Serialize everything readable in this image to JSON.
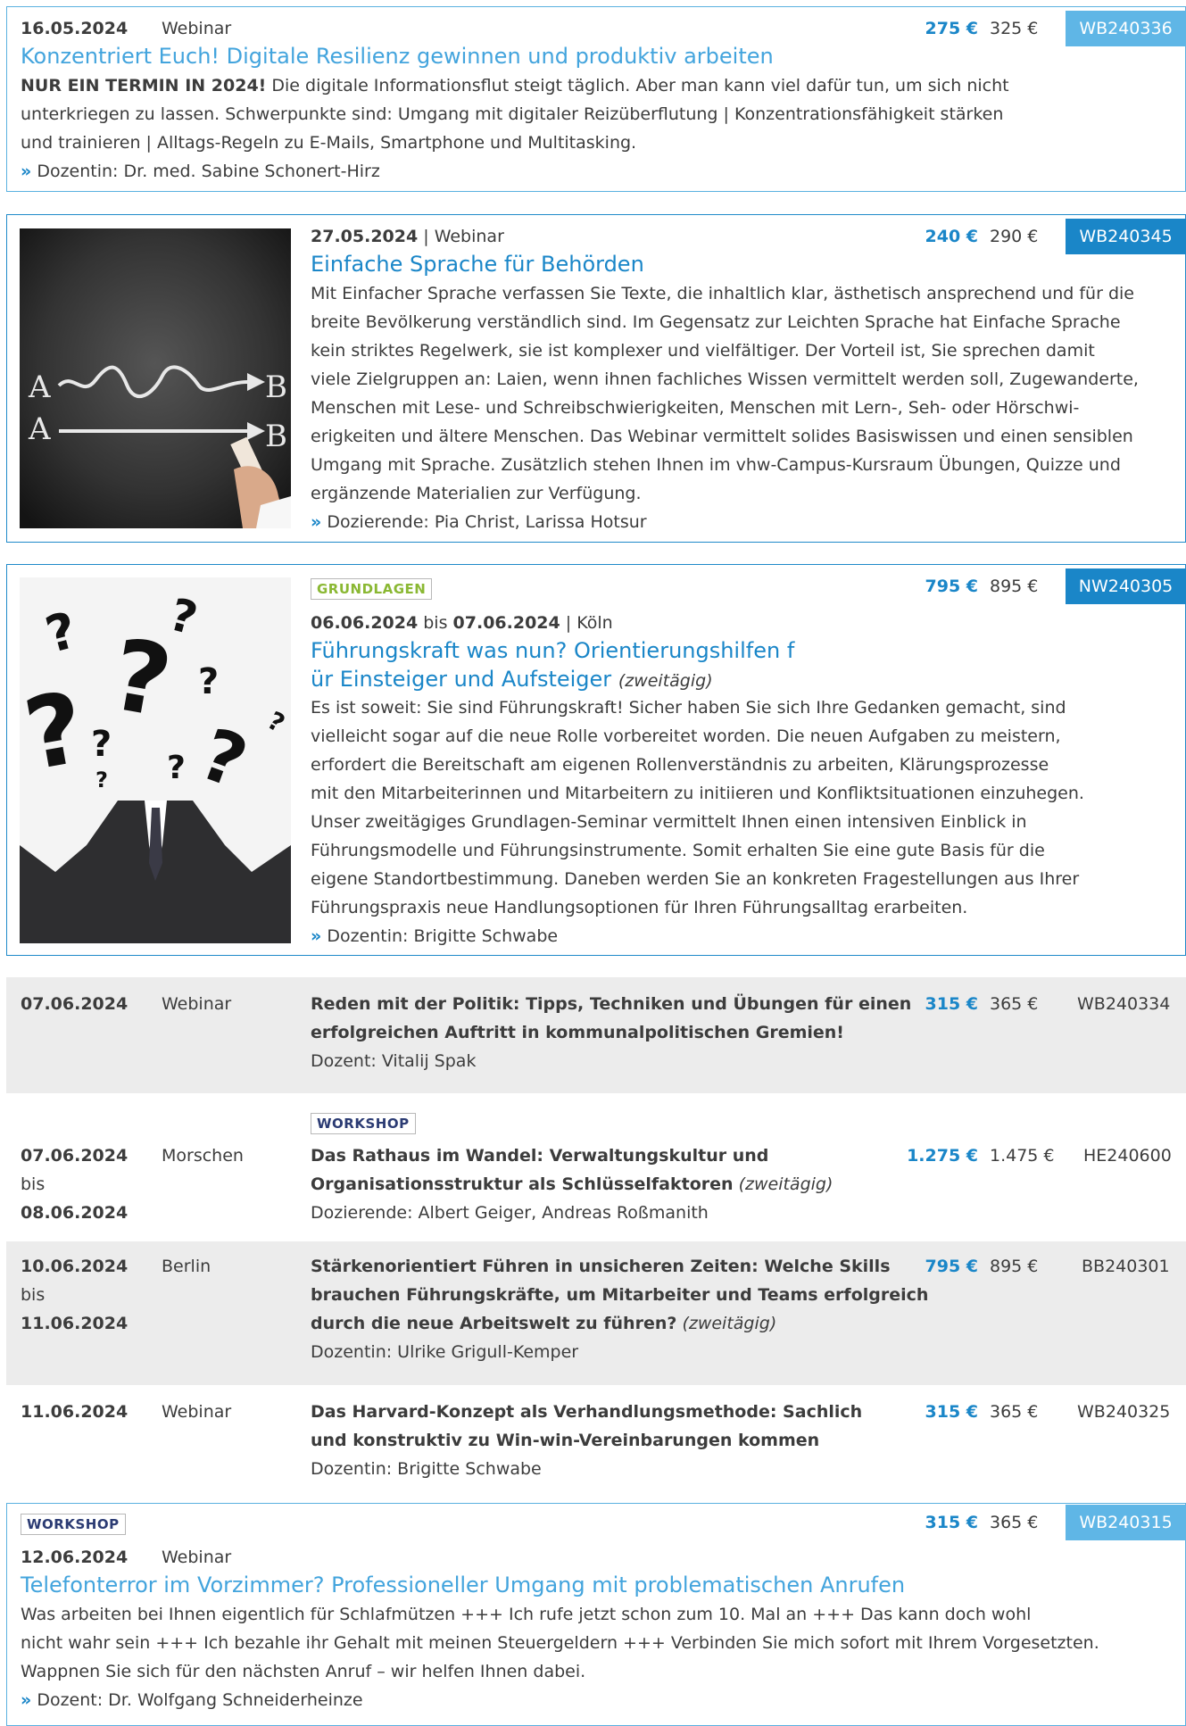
{
  "entry1": {
    "date": "16.05.2024",
    "format": "Webinar",
    "title": "Konzentriert Euch! Digitale Resilienz gewinnen und produktiv arbeiten",
    "lead_bold": "NUR EIN TERMIN IN 2024!",
    "desc_line1": " Die digitale Informationsflut steigt täglich. Aber man kann viel dafür tun, um sich nicht",
    "desc_line2": "unterkriegen zu lassen. Schwerpunkte sind: Umgang mit digitaler Reizüberflutung | Konzentrationsfähigkeit stärken",
    "desc_line3": "und trainieren | Alltags-Regeln zu E-Mails, Smartphone und Multitasking.",
    "teacher": "Dozentin: Dr. med. Sabine Schonert-Hirz",
    "price_new": "275 €",
    "price_old": "325 €",
    "code": "WB240336"
  },
  "entry2": {
    "date": "27.05.2024",
    "sep": " | ",
    "format": "Webinar",
    "title": "Einfache Sprache für Behörden",
    "lines": [
      "Mit Einfacher Sprache verfassen Sie Texte, die inhaltlich klar, ästhetisch ansprechend und für die",
      "breite Bevölkerung verständlich sind. Im Gegensatz zur Leichten Sprache hat Einfache Sprache",
      "kein striktes Regelwerk, sie ist komplexer und vielfältiger. Der Vorteil ist, Sie sprechen damit",
      "viele Zielgruppen an: Laien, wenn ihnen fachliches Wissen vermittelt werden soll, Zugewanderte,",
      "Menschen mit Lese- und Schreibschwierigkeiten, Menschen mit Lern-, Seh- oder Hörschwi-",
      "erigkeiten und ältere Menschen. Das Webinar vermittelt solides Basiswissen und einen sensiblen",
      "Umgang mit Sprache. Zusätzlich stehen Ihnen im vhw-Campus-Kursraum Übungen, Quizze und",
      "ergänzende Materialien zur Verfügung."
    ],
    "teacher": "Dozierende: Pia Christ, Larissa Hotsur",
    "price_new": "240 €",
    "price_old": "290 €",
    "code": "WB240345",
    "image_text": {
      "a1": "A",
      "b1": "B",
      "a2": "A",
      "b2": "B"
    }
  },
  "entry3": {
    "tag": "GRUNDLAGEN",
    "date_from": "06.06.2024",
    "bis": " bis ",
    "date_to": "07.06.2024",
    "sep": " | ",
    "location": "Köln",
    "title_line1": "Führungskraft was nun? Orientierungshilfen f",
    "title_line2": "ür Einsteiger und Aufsteiger",
    "duration": "(zweitägig)",
    "lines": [
      "Es ist soweit: Sie sind Führungskraft! Sicher haben Sie sich Ihre Gedanken gemacht, sind",
      "vielleicht sogar auf die neue Rolle vorbereitet worden. Die neuen Aufgaben zu meistern,",
      "erfordert die Bereitschaft am eigenen Rollenverständnis zu arbeiten, Klärungsprozesse",
      "mit den Mitarbeiterinnen und Mitarbeitern zu initiieren und Konfliktsituationen einzuhegen.",
      "Unser zweitägiges Grundlagen-Seminar vermittelt Ihnen einen intensiven Einblick in",
      "Führungsmodelle und Führungsinstrumente. Somit erhalten Sie eine gute Basis für die",
      "eigene Standortbestimmung. Daneben werden Sie an konkreten Fragestellungen aus Ihrer",
      "Führungspraxis neue Handlungsoptionen für Ihren Führungsalltag erarbeiten."
    ],
    "teacher": "Dozentin: Brigitte Schwabe",
    "price_new": "795 €",
    "price_old": "895 €",
    "code": "NW240305"
  },
  "rows": {
    "r1": {
      "date": "07.06.2024",
      "format": "Webinar",
      "title_line1": "Reden mit der Politik: Tipps, Techniken und Übungen für einen",
      "title_line2": "erfolgreichen Auftritt in kommunalpolitischen Gremien!",
      "teacher": "Dozent: Vitalij Spak",
      "price_new": "315 €",
      "price_old": "365 €",
      "code": "WB240334"
    },
    "r2": {
      "tag": "WORKSHOP",
      "date_from": "07.06.2024",
      "bis": "bis",
      "date_to": "08.06.2024",
      "location": "Morschen",
      "title_line1": "Das Rathaus im Wandel: Verwaltungskultur und",
      "title_line2": "Organisationsstruktur als Schlüsselfaktoren",
      "duration": " (zweitägig)",
      "teacher": "Dozierende: Albert Geiger, Andreas Roßmanith",
      "price_new": "1.275 €",
      "price_old": "1.475 €",
      "code": "HE240600"
    },
    "r3": {
      "date_from": "10.06.2024",
      "bis": "bis",
      "date_to": "11.06.2024",
      "location": "Berlin",
      "title_line1": "Stärkenorientiert Führen in unsicheren Zeiten: Welche Skills",
      "title_line2": "brauchen Führungskräfte, um Mitarbeiter und Teams erfolgreich",
      "title_line3": "durch die neue Arbeitswelt zu führen?",
      "duration": " (zweitägig)",
      "teacher": "Dozentin: Ulrike Grigull-Kemper",
      "price_new": "795 €",
      "price_old": "895 €",
      "code": "BB240301"
    },
    "r4": {
      "date": "11.06.2024",
      "format": "Webinar",
      "title_line1": "Das Harvard-Konzept als Verhandlungsmethode: Sachlich",
      "title_line2": "und konstruktiv zu Win-win-Vereinbarungen kommen",
      "teacher": "Dozentin: Brigitte Schwabe",
      "price_new": "315 €",
      "price_old": "365 €",
      "code": "WB240325"
    }
  },
  "entry4": {
    "tag": "WORKSHOP",
    "date": "12.06.2024",
    "format": "Webinar",
    "title": "Telefonterror im Vorzimmer? Professioneller Umgang mit problematischen Anrufen",
    "line1": "Was arbeiten bei Ihnen eigentlich für Schlafmützen +++ Ich rufe jetzt schon zum 10. Mal an +++ Das kann doch wohl",
    "line2": "nicht wahr sein +++ Ich bezahle ihr Gehalt mit meinen Steuergeldern +++ Verbinden Sie mich sofort mit Ihrem Vorgesetzten.",
    "line3": "Wappnen Sie sich für den nächsten Anruf – wir helfen Ihnen dabei.",
    "teacher": "Dozent: Dr. Wolfgang Schneiderheinze",
    "price_new": "315 €",
    "price_old": "365 €",
    "code": "WB240315"
  },
  "arrow_glyph": "»",
  "colors": {
    "accent": "#1a86c8",
    "accent_light": "#5fb6e6",
    "row_grey": "#ececec",
    "tag_green": "#8ab833",
    "tag_navy": "#2b3b73"
  }
}
